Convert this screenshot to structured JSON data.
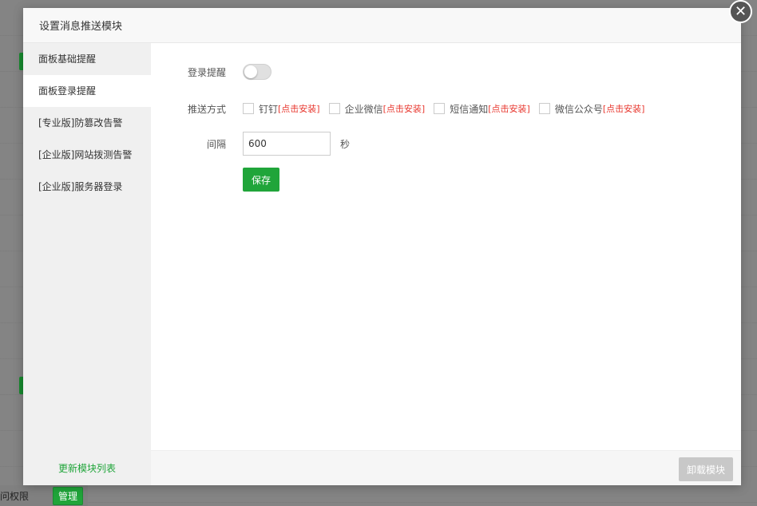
{
  "background": {
    "bottom_label": "问权限",
    "manage_button": "管理"
  },
  "modal": {
    "title": "设置消息推送模块",
    "close_icon": "close-icon"
  },
  "sidebar": {
    "items": [
      {
        "label": "面板基础提醒",
        "active": false
      },
      {
        "label": "面板登录提醒",
        "active": true
      },
      {
        "label": "[专业版]防篡改告警",
        "active": false
      },
      {
        "label": "[企业版]网站拨测告警",
        "active": false
      },
      {
        "label": "[企业版]服务器登录",
        "active": false
      }
    ],
    "footer_link": "更新模块列表"
  },
  "form": {
    "login_alert_label": "登录提醒",
    "login_alert_enabled": false,
    "push_method_label": "推送方式",
    "push_methods": [
      {
        "name": "钉钉",
        "install": "[点击安装]",
        "checked": false
      },
      {
        "name": "企业微信",
        "install": "[点击安装]",
        "checked": false
      },
      {
        "name": "短信通知",
        "install": "[点击安装]",
        "checked": false
      },
      {
        "name": "微信公众号",
        "install": "[点击安装]",
        "checked": false
      }
    ],
    "interval_label": "间隔",
    "interval_value": "600",
    "interval_unit": "秒",
    "save_button": "保存"
  },
  "footer": {
    "uninstall_button": "卸载模块"
  },
  "colors": {
    "accent_green": "#20a53a",
    "install_red": "#e8382f",
    "disabled_gray": "#c8c8c8"
  }
}
